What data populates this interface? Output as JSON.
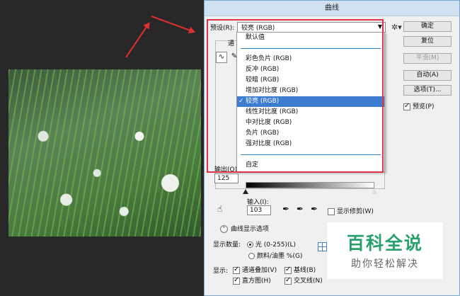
{
  "window": {
    "title": "曲线"
  },
  "preset": {
    "label": "预设(R):",
    "value": "较亮 (RGB)"
  },
  "dropdown": {
    "group1": [
      "默认值"
    ],
    "group2": [
      {
        "label": "彩色负片 (RGB)",
        "selected": false
      },
      {
        "label": "反冲 (RGB)",
        "selected": false
      },
      {
        "label": "较暗 (RGB)",
        "selected": false
      },
      {
        "label": "增加对比度 (RGB)",
        "selected": false
      },
      {
        "label": "较亮 (RGB)",
        "selected": true
      },
      {
        "label": "线性对比度 (RGB)",
        "selected": false
      },
      {
        "label": "中对比度 (RGB)",
        "selected": false
      },
      {
        "label": "负片 (RGB)",
        "selected": false
      },
      {
        "label": "强对比度 (RGB)",
        "selected": false
      }
    ],
    "group3": [
      "自定"
    ]
  },
  "buttons": {
    "ok": "确定",
    "reset": "复位",
    "smooth": "平滑(M)",
    "auto": "自动(A)",
    "options": "选项(T)...",
    "preview": "预览(P)"
  },
  "channel_prefix": "通",
  "output": {
    "label": "输出(O):",
    "value": "125"
  },
  "input": {
    "label": "输入(I):",
    "value": "103"
  },
  "show_clipping": "显示修剪(W)",
  "curve_display_options": "曲线显示选项",
  "display_amount": {
    "label": "显示数量:",
    "light": "光 (0-255)(L)",
    "pigment": "颜料/油墨 %(G)"
  },
  "show": {
    "label": "显示:",
    "channel_overlay": "通道叠加(V)",
    "baseline": "基线(B)",
    "histogram": "直方图(H)",
    "intersection": "交叉线(N)"
  },
  "watermark": {
    "title": "百科全说",
    "subtitle": "助你轻松解决"
  },
  "colors": {
    "accent": "#3c7dd0",
    "highlight_box": "#e0324b",
    "arrow": "#e03030",
    "watermark": "#27a06b"
  }
}
